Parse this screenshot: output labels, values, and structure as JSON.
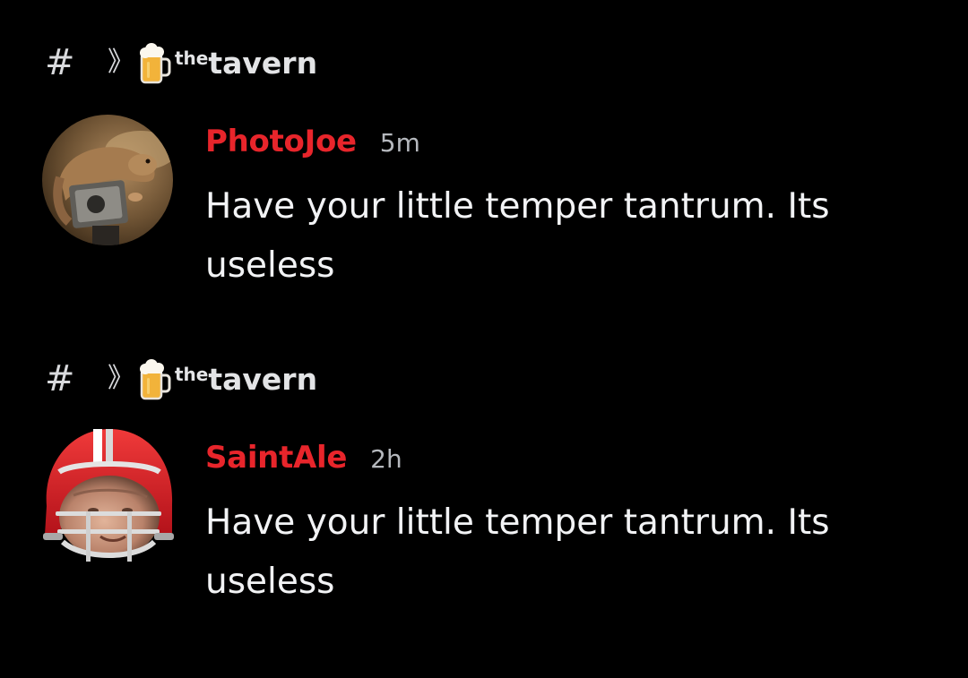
{
  "messages": [
    {
      "channel": {
        "hash": "#",
        "chevron": "》",
        "icon": "beer-mug-icon",
        "prefix": "the",
        "name": "tavern"
      },
      "author": "PhotoJoe",
      "time": "5m",
      "text": "Have your little temper tantrum. Its useless",
      "avatar": "weasel-camera-avatar"
    },
    {
      "channel": {
        "hash": "#",
        "chevron": "》",
        "icon": "beer-mug-icon",
        "prefix": "the",
        "name": "tavern"
      },
      "author": "SaintAle",
      "time": "2h",
      "text": "Have your little temper tantrum. Its useless",
      "avatar": "football-helmet-avatar"
    }
  ],
  "colors": {
    "background": "#000000",
    "username": "#e8252b",
    "text": "#f2f3f5",
    "timestamp": "#b5b8bd"
  }
}
